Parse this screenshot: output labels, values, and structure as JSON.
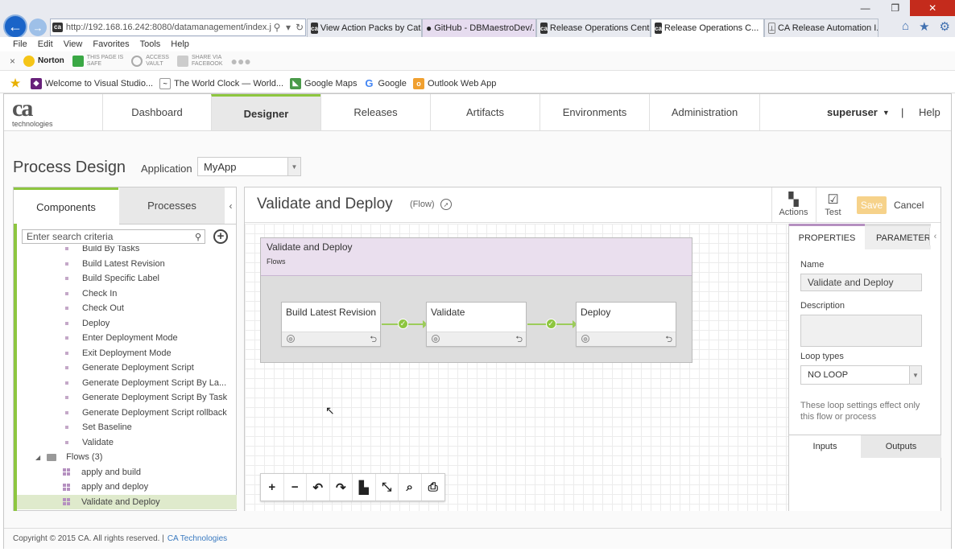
{
  "browser": {
    "url": "http://192.168.16.242:8080/datamanagement/index.jsp#",
    "tabs": [
      {
        "label": "View Action Packs by Cat...",
        "icon": "ca",
        "active": false
      },
      {
        "label": "GitHub - DBMaestroDev/...",
        "icon": "github",
        "active": false
      },
      {
        "label": "Release Operations Center",
        "icon": "ca",
        "active": false
      },
      {
        "label": "Release Operations C...",
        "icon": "ca",
        "active": true
      },
      {
        "label": "CA Release Automation I...",
        "icon": "doc",
        "active": false
      }
    ],
    "menu": [
      "File",
      "Edit",
      "View",
      "Favorites",
      "Tools",
      "Help"
    ],
    "toolbar": {
      "norton": "Norton",
      "safe_line1": "THIS PAGE IS",
      "safe_line2": "SAFE",
      "vault_line1": "ACCESS",
      "vault_line2": "VAULT",
      "share_line1": "SHARE VIA",
      "share_line2": "FACEBOOK"
    },
    "favorites": [
      "Welcome to Visual Studio...",
      "The World Clock — World...",
      "Google Maps",
      "Google",
      "Outlook Web App"
    ]
  },
  "app": {
    "logo": {
      "mark": "ca",
      "sub": "technologies"
    },
    "nav": [
      "Dashboard",
      "Designer",
      "Releases",
      "Artifacts",
      "Environments",
      "Administration"
    ],
    "active_nav": "Designer",
    "user": "superuser",
    "separator": "|",
    "help": "Help",
    "page_title": "Process Design",
    "application_label": "Application",
    "application_value": "MyApp"
  },
  "left": {
    "tabs": [
      "Components",
      "Processes"
    ],
    "search_placeholder": "Enter search criteria",
    "tree": [
      {
        "label": "Build By Tasks",
        "kind": "action"
      },
      {
        "label": "Build Latest Revision",
        "kind": "action"
      },
      {
        "label": "Build Specific Label",
        "kind": "action"
      },
      {
        "label": "Check In",
        "kind": "action"
      },
      {
        "label": "Check Out",
        "kind": "action"
      },
      {
        "label": "Deploy",
        "kind": "action"
      },
      {
        "label": "Enter Deployment Mode",
        "kind": "action"
      },
      {
        "label": "Exit Deployment Mode",
        "kind": "action"
      },
      {
        "label": "Generate Deployment Script",
        "kind": "action"
      },
      {
        "label": "Generate Deployment Script By La...",
        "kind": "action"
      },
      {
        "label": "Generate Deployment Script By Task",
        "kind": "action"
      },
      {
        "label": "Generate Deployment Script rollback",
        "kind": "action"
      },
      {
        "label": "Set Baseline",
        "kind": "action"
      },
      {
        "label": "Validate",
        "kind": "action"
      },
      {
        "label": "Flows (3)",
        "kind": "folder"
      },
      {
        "label": "apply and build",
        "kind": "flow"
      },
      {
        "label": "apply and deploy",
        "kind": "flow"
      },
      {
        "label": "Validate and Deploy",
        "kind": "flow",
        "selected": true
      }
    ]
  },
  "main": {
    "title": "Validate and Deploy",
    "type_label": "(Flow)",
    "actions_label": "Actions",
    "test_label": "Test",
    "save_label": "Save",
    "cancel_label": "Cancel",
    "flow": {
      "title": "Validate and Deploy",
      "subtitle": "Flows",
      "nodes": [
        "Build Latest Revision",
        "Validate",
        "Deploy"
      ]
    },
    "canvas_toolbar": [
      "+",
      "−",
      "↶",
      "↷",
      "layout",
      "shrink",
      "find",
      "print"
    ]
  },
  "props": {
    "tabs": [
      "PROPERTIES",
      "PARAMETERS"
    ],
    "name_label": "Name",
    "name_value": "Validate and Deploy",
    "description_label": "Description",
    "description_value": "",
    "loop_label": "Loop types",
    "loop_value": "NO LOOP",
    "loop_note": "These loop settings effect only this flow or process",
    "io_tabs": [
      "Inputs",
      "Outputs"
    ]
  },
  "footer": {
    "copyright": "Copyright © 2015 CA. All rights reserved.  |",
    "link": "CA Technologies"
  },
  "colors": {
    "accent_green": "#8dc63f",
    "accent_purple": "#b590c0",
    "save_disabled": "#f6d28a",
    "browser_blue": "#1a64c8"
  }
}
